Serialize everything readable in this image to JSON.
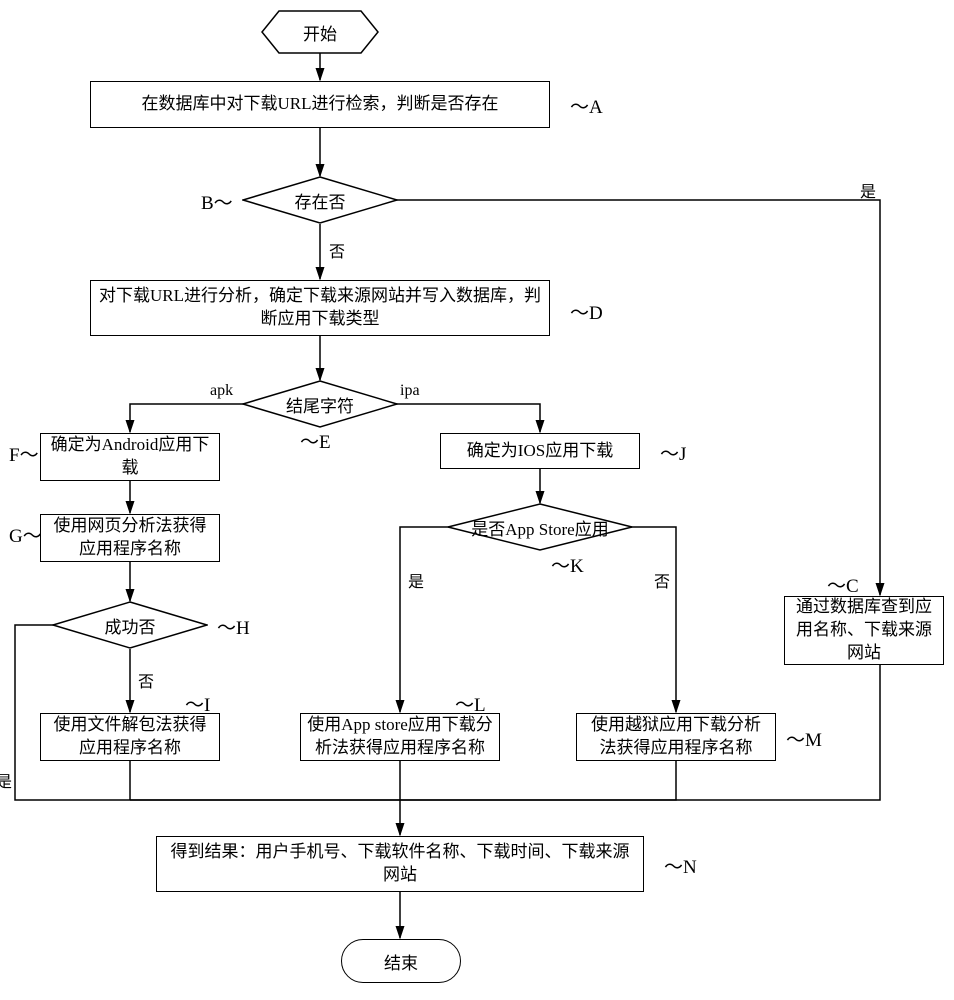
{
  "terminals": {
    "start": "开始",
    "end": "结束"
  },
  "nodes": {
    "A": "在数据库中对下载URL进行检索，判断是否存在",
    "B": "存在否",
    "C": "通过数据库查到应用名称、下载来源网站",
    "D": "对下载URL进行分析，确定下载来源网站并写入数据库，判断应用下载类型",
    "E": "结尾字符",
    "F": "确定为Android应用下载",
    "G": "使用网页分析法获得应用程序名称",
    "H": "成功否",
    "I": "使用文件解包法获得应用程序名称",
    "J": "确定为IOS应用下载",
    "K": "是否App Store应用",
    "L": "使用App store应用下载分析法获得应用程序名称",
    "M": "使用越狱应用下载分析法获得应用程序名称",
    "N": "得到结果：用户手机号、下载软件名称、下载时间、下载来源网站"
  },
  "labels": {
    "A": "～A",
    "B": "B～",
    "C": "～C",
    "D": "～D",
    "E": "～E",
    "F": "F～",
    "G": "G～",
    "H": "～H",
    "I": "～I",
    "J": "～J",
    "K": "～K",
    "L": "～L",
    "M": "～M",
    "N": "～N"
  },
  "edges": {
    "yes": "是",
    "no": "否",
    "apk": "apk",
    "ipa": "ipa"
  }
}
